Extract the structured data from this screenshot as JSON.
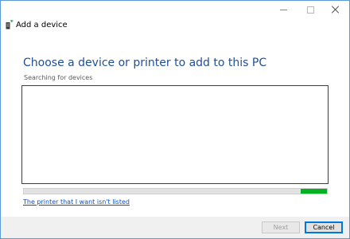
{
  "window": {
    "title": "Add a device"
  },
  "main": {
    "heading": "Choose a device or printer to add to this PC",
    "status": "Searching for devices",
    "device_list": [],
    "link": "The printer that I want isn't listed"
  },
  "footer": {
    "next_label": "Next",
    "cancel_label": "Cancel"
  },
  "colors": {
    "heading": "#1f4e9a",
    "progress": "#06b025",
    "link": "#0a4fbf"
  }
}
